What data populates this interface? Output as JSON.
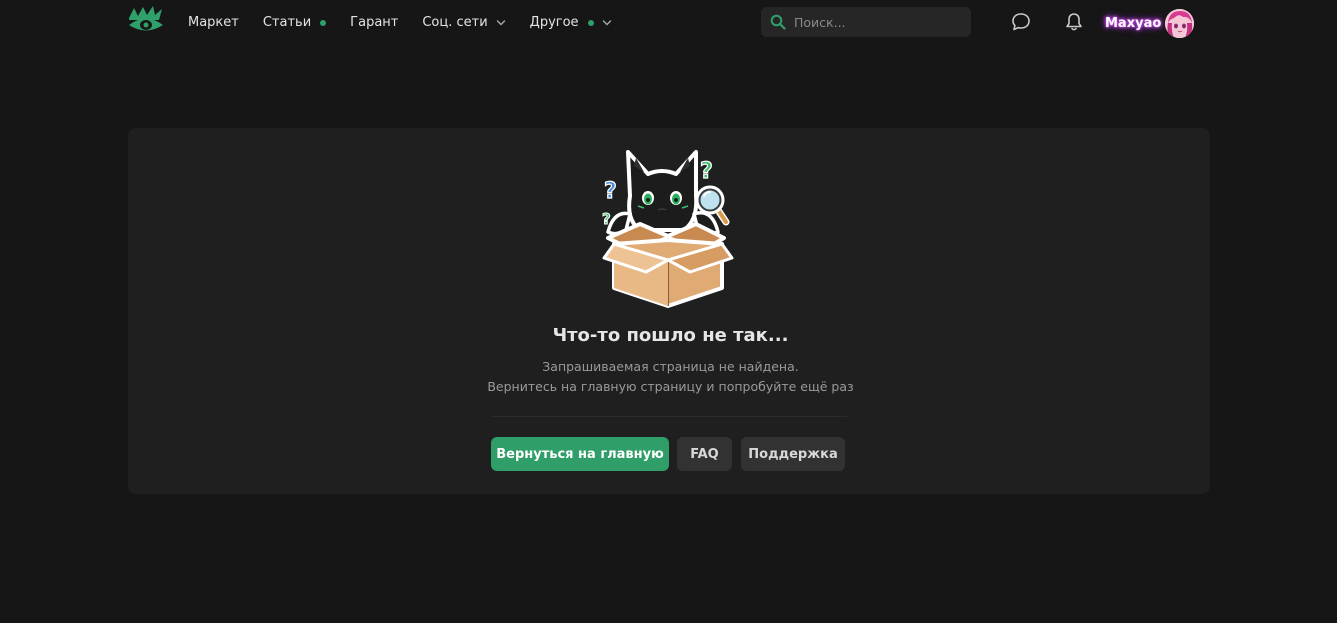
{
  "header": {
    "logo_name": "eye-crown-logo",
    "nav": [
      {
        "label": "Маркет",
        "dot": false,
        "dropdown": false
      },
      {
        "label": "Статьи",
        "dot": true,
        "dropdown": false
      },
      {
        "label": "Гарант",
        "dot": false,
        "dropdown": false
      },
      {
        "label": "Соц. сети",
        "dot": false,
        "dropdown": true
      },
      {
        "label": "Другое",
        "dot": true,
        "dropdown": true
      }
    ],
    "search": {
      "placeholder": "Поиск...",
      "value": ""
    },
    "icons": [
      "chat-bubble-icon",
      "bell-icon"
    ],
    "user": {
      "name": "Maxyao"
    }
  },
  "error_card": {
    "title": "Что-то пошло не так...",
    "message_line1": "Запрашиваемая страница не найдена.",
    "message_line2": "Вернитесь на главную страницу и попробуйте ещё раз",
    "buttons": {
      "home": "Вернуться на главную",
      "faq": "FAQ",
      "support": "Поддержка"
    }
  },
  "colors": {
    "background": "#161616",
    "card": "#1f1f1f",
    "accent": "#2f9e68",
    "secondary_button": "#323232",
    "username_glow": "#d044ff"
  }
}
